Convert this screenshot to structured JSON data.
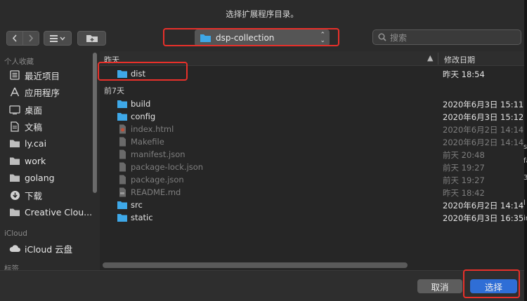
{
  "dialog": {
    "title": "选择扩展程序目录。"
  },
  "toolbar": {
    "back_icon": "chevron-left",
    "forward_icon": "chevron-right",
    "view_icon": "list-view",
    "new_folder_icon": "folder-plus",
    "location": "dsp-collection",
    "search_placeholder": "搜索"
  },
  "sidebar": {
    "favorites_header": "个人收藏",
    "favorites": [
      {
        "label": "最近项目",
        "icon": "recents-icon"
      },
      {
        "label": "应用程序",
        "icon": "applications-icon"
      },
      {
        "label": "桌面",
        "icon": "desktop-icon"
      },
      {
        "label": "文稿",
        "icon": "documents-icon"
      },
      {
        "label": "ly.cai",
        "icon": "folder-icon"
      },
      {
        "label": "work",
        "icon": "folder-icon"
      },
      {
        "label": "golang",
        "icon": "folder-icon"
      },
      {
        "label": "下载",
        "icon": "downloads-icon"
      },
      {
        "label": "Creative Clou...",
        "icon": "folder-icon"
      }
    ],
    "icloud_header": "iCloud",
    "icloud": [
      {
        "label": "iCloud 云盘",
        "icon": "cloud-icon"
      }
    ],
    "tags_header": "标签"
  },
  "file_list": {
    "col_name": "昨天",
    "col_date": "修改日期",
    "sort_indicator": "▲",
    "group_yesterday": "昨天",
    "group_week": "前7天",
    "yesterday_rows": [
      {
        "name": "dist",
        "date": "昨天 18:54",
        "kind": "folder",
        "dim": false
      }
    ],
    "week_rows": [
      {
        "name": "build",
        "date": "2020年6月3日 15:11",
        "kind": "folder",
        "dim": false
      },
      {
        "name": "config",
        "date": "2020年6月3日 15:12",
        "kind": "folder",
        "dim": false
      },
      {
        "name": "index.html",
        "date": "2020年6月2日 14:14",
        "kind": "html",
        "dim": true
      },
      {
        "name": "Makefile",
        "date": "2020年6月2日 14:14",
        "kind": "doc",
        "dim": true
      },
      {
        "name": "manifest.json",
        "date": "前天 20:48",
        "kind": "doc",
        "dim": true
      },
      {
        "name": "package-lock.json",
        "date": "前天 19:27",
        "kind": "doc",
        "dim": true
      },
      {
        "name": "package.json",
        "date": "前天 19:27",
        "kind": "doc",
        "dim": true
      },
      {
        "name": "README.md",
        "date": "昨天 18:42",
        "kind": "md",
        "dim": true
      },
      {
        "name": "src",
        "date": "2020年6月2日 14:14",
        "kind": "folder",
        "dim": false
      },
      {
        "name": "static",
        "date": "2020年6月3日 16:35",
        "kind": "folder",
        "dim": false
      }
    ]
  },
  "buttons": {
    "cancel": "取消",
    "choose": "选择"
  },
  "colors": {
    "highlight_box": "#e8302a",
    "folder": "#3ea8e8",
    "primary": "#2f6ed6"
  },
  "edge_fragments": [
    "s",
    "fa",
    "3",
    "l",
    "in"
  ]
}
